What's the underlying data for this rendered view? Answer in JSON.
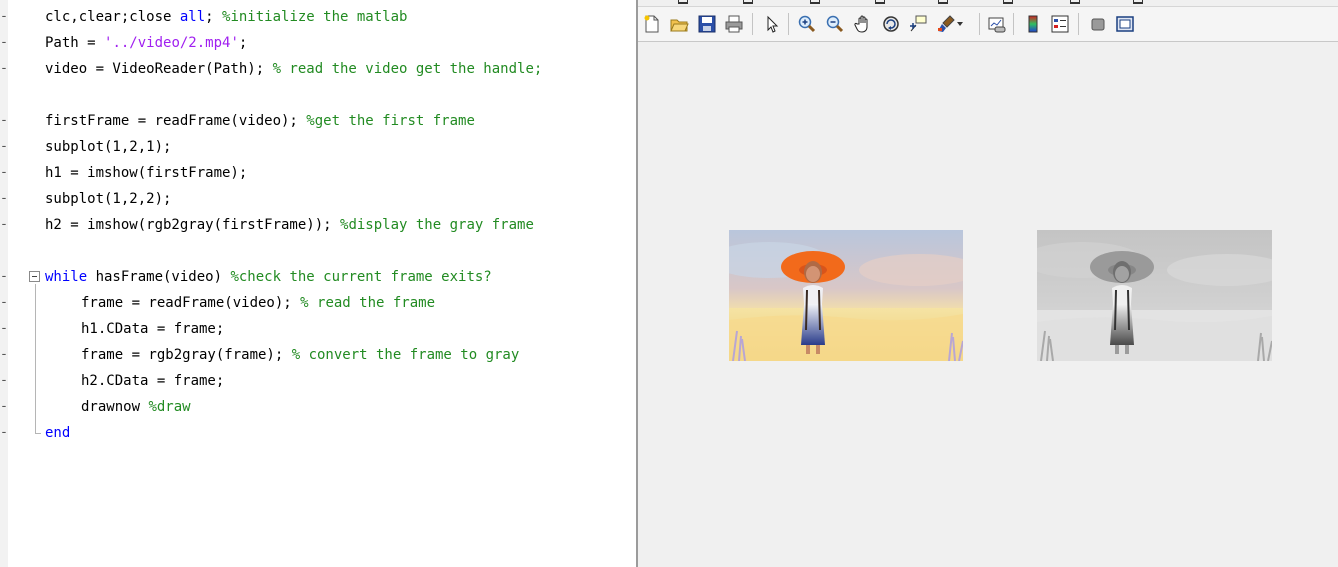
{
  "editor": {
    "lines": [
      {
        "marker": "-",
        "tokens": [
          {
            "t": "clc,clear;close ",
            "c": "t"
          },
          {
            "t": "all",
            "c": "k"
          },
          {
            "t": "; ",
            "c": "t"
          },
          {
            "t": "%initialize the matlab",
            "c": "c"
          }
        ]
      },
      {
        "marker": "-",
        "tokens": [
          {
            "t": "Path = ",
            "c": "t"
          },
          {
            "t": "'../video/2.mp4'",
            "c": "s"
          },
          {
            "t": ";",
            "c": "t"
          }
        ]
      },
      {
        "marker": "-",
        "tokens": [
          {
            "t": "video = VideoReader(Path); ",
            "c": "t"
          },
          {
            "t": "% read the video get the handle;",
            "c": "c"
          }
        ]
      },
      {
        "marker": "",
        "tokens": []
      },
      {
        "marker": "-",
        "tokens": [
          {
            "t": "firstFrame = readFrame(video); ",
            "c": "t"
          },
          {
            "t": "%get the first frame",
            "c": "c"
          }
        ]
      },
      {
        "marker": "-",
        "tokens": [
          {
            "t": "subplot(1,2,1);",
            "c": "t"
          }
        ]
      },
      {
        "marker": "-",
        "tokens": [
          {
            "t": "h1 = imshow(firstFrame);",
            "c": "t"
          }
        ]
      },
      {
        "marker": "-",
        "tokens": [
          {
            "t": "subplot(1,2,2);",
            "c": "t"
          }
        ]
      },
      {
        "marker": "-",
        "tokens": [
          {
            "t": "h2 = imshow(rgb2gray(firstFrame)); ",
            "c": "t"
          },
          {
            "t": "%display the gray frame",
            "c": "c"
          }
        ]
      },
      {
        "marker": "",
        "tokens": []
      },
      {
        "marker": "-",
        "tokens": [
          {
            "t": "while ",
            "c": "k"
          },
          {
            "t": "hasFrame(video) ",
            "c": "t"
          },
          {
            "t": "%check the current frame exits?",
            "c": "c"
          }
        ]
      },
      {
        "marker": "-",
        "indent": 1,
        "tokens": [
          {
            "t": "frame = readFrame(video); ",
            "c": "t"
          },
          {
            "t": "% read the frame",
            "c": "c"
          }
        ]
      },
      {
        "marker": "-",
        "indent": 1,
        "tokens": [
          {
            "t": "h1.CData = frame;",
            "c": "t"
          }
        ]
      },
      {
        "marker": "-",
        "indent": 1,
        "tokens": [
          {
            "t": "frame = rgb2gray(frame); ",
            "c": "t"
          },
          {
            "t": "% convert the frame to gray",
            "c": "c"
          }
        ]
      },
      {
        "marker": "-",
        "indent": 1,
        "tokens": [
          {
            "t": "h2.CData = frame;",
            "c": "t"
          }
        ]
      },
      {
        "marker": "-",
        "indent": 1,
        "tokens": [
          {
            "t": "drawnow ",
            "c": "t"
          },
          {
            "t": "%draw",
            "c": "c"
          }
        ]
      },
      {
        "marker": "-",
        "tokens": [
          {
            "t": "end",
            "c": "k"
          }
        ]
      }
    ]
  },
  "figure": {
    "toolbar": [
      {
        "name": "new-figure-icon"
      },
      {
        "name": "open-file-icon"
      },
      {
        "name": "save-icon"
      },
      {
        "name": "print-icon"
      },
      {
        "name": "separator"
      },
      {
        "name": "select-arrow-icon"
      },
      {
        "name": "separator"
      },
      {
        "name": "zoom-in-icon"
      },
      {
        "name": "zoom-out-icon"
      },
      {
        "name": "pan-hand-icon"
      },
      {
        "name": "rotate-3d-icon"
      },
      {
        "name": "data-cursor-icon"
      },
      {
        "name": "brush-icon"
      },
      {
        "name": "dropdown-arrow-icon"
      },
      {
        "name": "separator"
      },
      {
        "name": "link-plot-icon"
      },
      {
        "name": "separator"
      },
      {
        "name": "colorbar-icon"
      },
      {
        "name": "legend-icon"
      },
      {
        "name": "separator"
      },
      {
        "name": "hide-plot-tools-icon"
      },
      {
        "name": "show-plot-tools-icon"
      }
    ],
    "images": [
      {
        "name": "first-frame-image",
        "mode": "color"
      },
      {
        "name": "gray-frame-image",
        "mode": "gray"
      }
    ]
  },
  "colors": {
    "keyword": "#0000ff",
    "string": "#a020f0",
    "comment": "#228b22",
    "figure_bg": "#f0f0f0"
  }
}
